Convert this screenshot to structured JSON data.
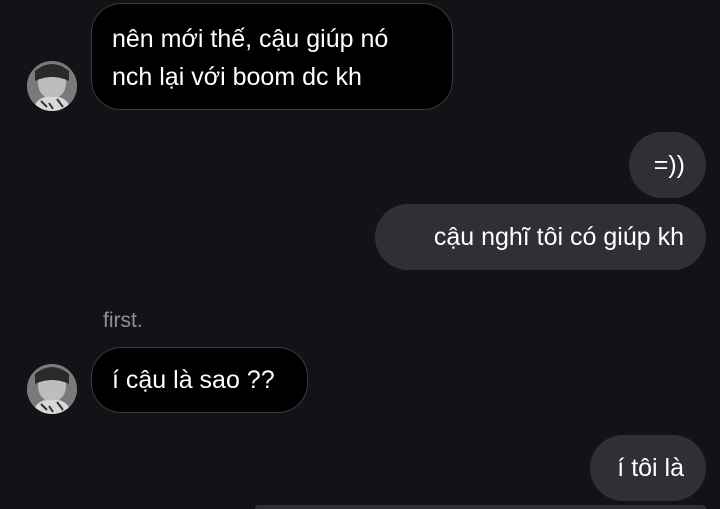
{
  "thread": {
    "msg1": {
      "line1": "nên mới thế, cậu giúp nó",
      "line2": "nch lại với boom dc kh"
    },
    "msg2": {
      "text": "=))"
    },
    "msg3": {
      "text": "cậu nghĩ tôi có giúp kh"
    },
    "sender_name": "first.",
    "msg4": {
      "text": "í cậu là sao ??"
    },
    "msg5": {
      "text": "í tôi là"
    }
  },
  "colors": {
    "background": "#121217",
    "incoming_bubble": "#000000",
    "incoming_border": "#3a3a3f",
    "outgoing_bubble": "#2f3035",
    "sender_name": "#8f8f94",
    "text": "#ffffff"
  },
  "icons": {
    "avatar": "avatar-photo"
  }
}
